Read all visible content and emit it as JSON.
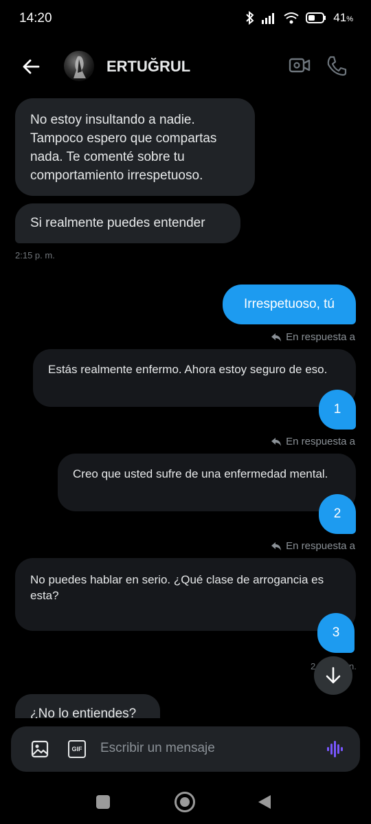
{
  "status_bar": {
    "time": "14:20",
    "battery": "41"
  },
  "header": {
    "contact_name": "ERTUĞRUL"
  },
  "messages": [
    {
      "text": "No estoy insultando a nadie. Tampoco espero que compartas nada. Te comenté sobre tu comportamiento irrespetuoso."
    },
    {
      "text": "Si realmente puedes entender"
    },
    {
      "time": "2:15 p. m."
    },
    {
      "text": "Irrespetuoso, tú"
    },
    {
      "reply_label": "En respuesta a",
      "quote": "Estás realmente enfermo. Ahora estoy seguro de eso.",
      "reply": "1"
    },
    {
      "reply_label": "En respuesta a",
      "quote": "Creo que usted sufre de una enfermedad mental.",
      "reply": "2"
    },
    {
      "reply_label": "En respuesta a",
      "quote": "No puedes hablar en serio. ¿Qué clase de arrogancia es esta?",
      "reply": "3"
    },
    {
      "time_partial_left": "2",
      "time_partial_right": "n."
    },
    {
      "text": "¿No lo entiendes?"
    }
  ],
  "composer": {
    "placeholder": "Escribir un mensaje",
    "gif_label": "GIF"
  },
  "colors": {
    "accent": "#1d9bf0",
    "bubble_in": "#202327",
    "background": "#000000"
  },
  "icons": [
    "back-arrow-icon",
    "video-call-icon",
    "phone-icon",
    "reply-arrow-icon",
    "image-icon",
    "gif-icon",
    "voice-icon",
    "arrow-down-icon"
  ]
}
